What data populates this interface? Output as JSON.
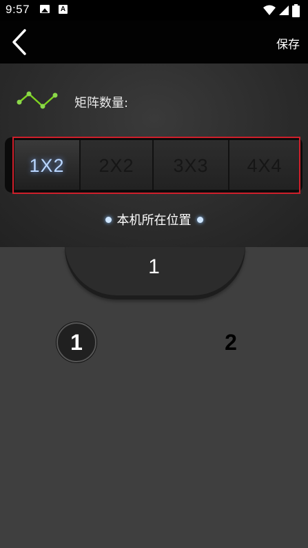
{
  "status_bar": {
    "time": "9:57"
  },
  "header": {
    "save_label": "保存"
  },
  "matrix": {
    "label": "矩阵数量:",
    "options": [
      "1X2",
      "2X2",
      "3X3",
      "4X4"
    ],
    "selected": "1X2"
  },
  "location": {
    "label": "本机所在位置"
  },
  "host": {
    "number": "1"
  },
  "positions": [
    "1",
    "2"
  ],
  "colors": {
    "accent_glow": "#b9d6ff",
    "highlight_outline": "#d01f2b",
    "matrix_icon": "#7ed321"
  }
}
